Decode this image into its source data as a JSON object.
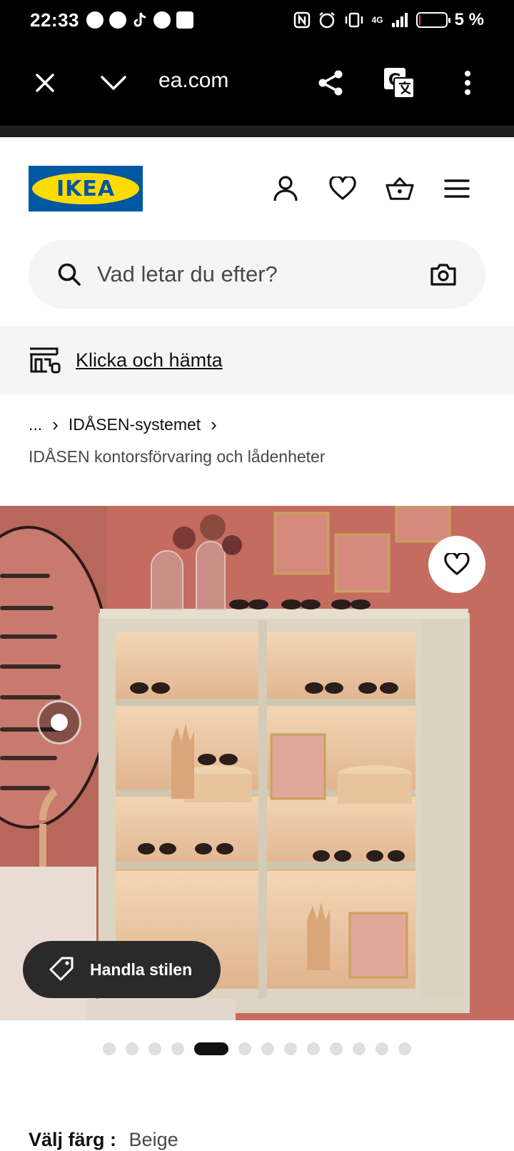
{
  "status_bar": {
    "time": "22:33",
    "network": "4G",
    "battery": "5 %",
    "battery_level": 0.05
  },
  "browser": {
    "url": "ea.com"
  },
  "header": {
    "logo_text": "IKEA"
  },
  "search": {
    "placeholder": "Vad letar du efter?"
  },
  "click_collect": {
    "label": "Klicka och hämta"
  },
  "breadcrumb": {
    "ellipsis": "...",
    "item": "IDÅSEN-systemet",
    "current": "IDÅSEN kontorsförvaring och lådenheter"
  },
  "hero": {
    "shop_style_label": "Handla stilen"
  },
  "carousel": {
    "count": 13,
    "active_index": 4
  },
  "product": {
    "color_label": "Välj färg :",
    "color_value": "Beige"
  },
  "colors": {
    "ikea_blue": "#0058a3",
    "ikea_yellow": "#ffdb00",
    "wall": "#c46c60"
  }
}
